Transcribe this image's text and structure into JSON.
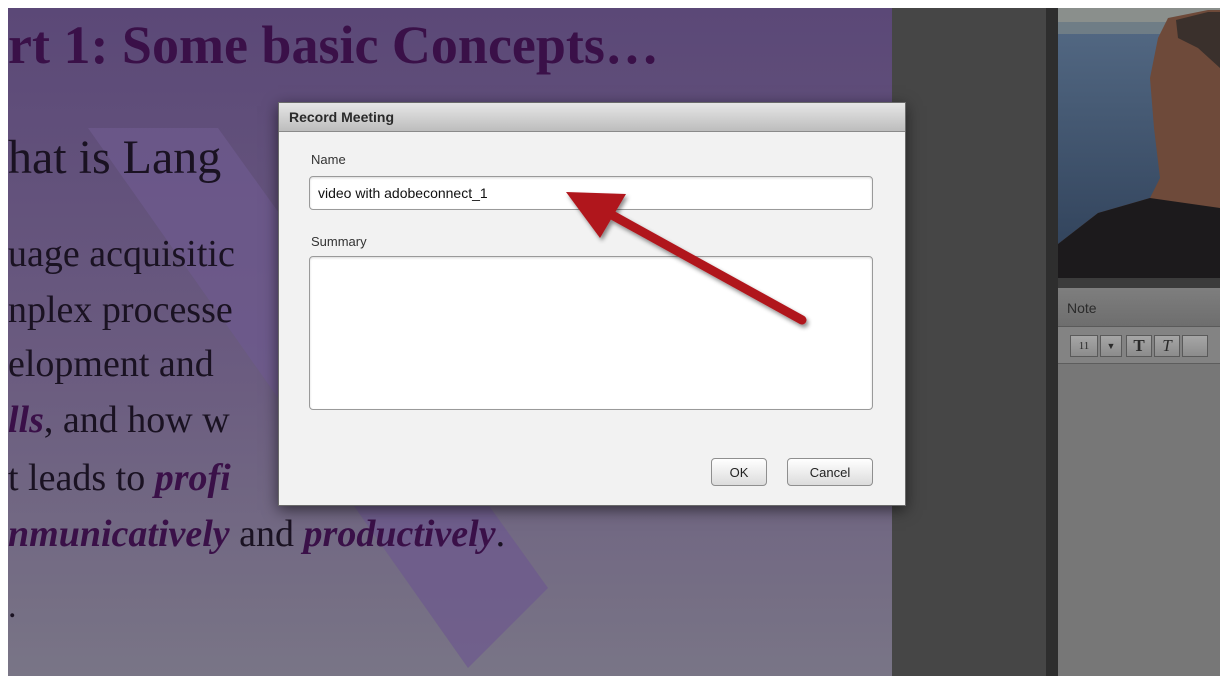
{
  "slide": {
    "title": "rt 1: Some basic Concepts…",
    "subtitle": "hat is Lang",
    "lines": [
      {
        "a": "uage acquisitic",
        "b": "",
        "c": ""
      },
      {
        "a": "nplex processe",
        "b": "",
        "c": ""
      },
      {
        "a": "elopment and",
        "b": "",
        "c": ""
      },
      {
        "a": "",
        "b": "lls",
        "c": ", and how w"
      },
      {
        "a": "t leads to ",
        "b": "profi",
        "c": ""
      },
      {
        "a": "",
        "b": "nmunicatively",
        "c": " and "
      }
    ],
    "line6_emph2": "productively",
    "line6_end": ".",
    "mark": "."
  },
  "note_pod": {
    "title": "Note",
    "font_size": "11",
    "dropdown_icon": "chevron-down-icon",
    "bold_label": "T",
    "italic_label": "T"
  },
  "dialog": {
    "title": "Record Meeting",
    "name_label": "Name",
    "name_value": "video with adobeconnect_1",
    "summary_label": "Summary",
    "summary_value": "",
    "ok_label": "OK",
    "cancel_label": "Cancel"
  },
  "colors": {
    "slide_background": "#5c4a78",
    "slide_emphasis": "#3a1048",
    "arrow": "#b0141c"
  }
}
